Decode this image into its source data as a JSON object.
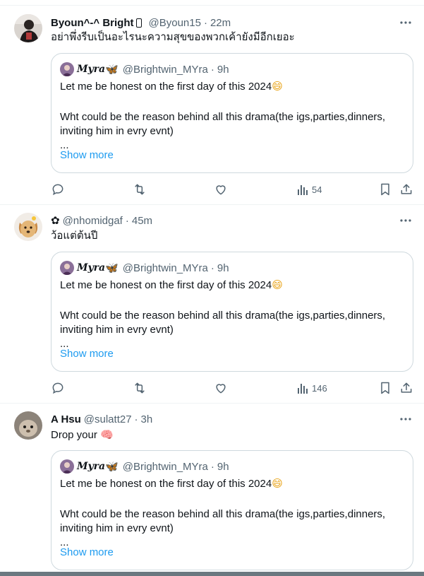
{
  "colors": {
    "accent": "#1d9bf0",
    "secondary_text": "#536471",
    "border": "#cfd9de"
  },
  "tweets": [
    {
      "name": "Byoun^-^ Bright",
      "handle": "@Byoun15",
      "separator": "·",
      "time": "22m",
      "text": "อย่าพึ่งรีบเป็นอะไรนะความสุขของพวกเค้ายังมีอีกเยอะ",
      "views": "54",
      "quote": {
        "name": "Myra",
        "name_emoji": "🦋",
        "handle": "@Brightwin_MYra",
        "separator": "·",
        "time": "9h",
        "line1": "Let me be honest on the first day of this 2024",
        "line1_emoji": "😄",
        "line2": "Wht could be the reason behind all this drama(the igs,parties,dinners,",
        "line3": "inviting him in evry evnt)",
        "line4": "...",
        "show_more": "Show more"
      }
    },
    {
      "name": "✿",
      "handle": "@nhomidgaf",
      "separator": "·",
      "time": "45m",
      "text": "ว้อแต่ต้นปี",
      "views": "146",
      "quote": {
        "name": "Myra",
        "name_emoji": "🦋",
        "handle": "@Brightwin_MYra",
        "separator": "·",
        "time": "9h",
        "line1": "Let me be honest on the first day of this 2024",
        "line1_emoji": "😄",
        "line2": "Wht could be the reason behind all this drama(the igs,parties,dinners,",
        "line3": "inviting him in evry evnt)",
        "line4": "...",
        "show_more": "Show more"
      }
    },
    {
      "name": "A Hsu",
      "handle": "@sulatt27",
      "separator": "·",
      "time": "3h",
      "text": "Drop your",
      "text_emoji": "🧠",
      "quote": {
        "name": "Myra",
        "name_emoji": "🦋",
        "handle": "@Brightwin_MYra",
        "separator": "·",
        "time": "9h",
        "line1": "Let me be honest on the first day of this 2024",
        "line1_emoji": "😄",
        "line2": "Wht could be the reason behind all this drama(the igs,parties,dinners,",
        "line3": "inviting him in evry evnt)",
        "line4": "...",
        "show_more": "Show more"
      }
    }
  ]
}
